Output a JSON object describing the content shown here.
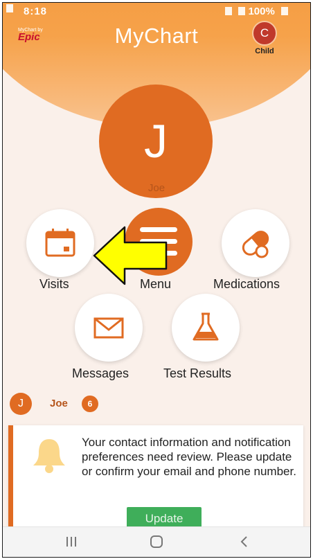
{
  "status": {
    "time": "8:18",
    "battery": "100%"
  },
  "header": {
    "brand_small": "MyChart by",
    "brand": "Epic",
    "title": "MyChart"
  },
  "proxy": {
    "initial": "C",
    "label": "Child"
  },
  "profile": {
    "initial": "J",
    "name": "Joe"
  },
  "tiles": {
    "visits": "Visits",
    "menu": "Menu",
    "medications": "Medications",
    "messages": "Messages",
    "test_results": "Test Results"
  },
  "person": {
    "initial": "J",
    "name": "Joe",
    "badge": "6"
  },
  "notice": {
    "text": "Your contact information and notification preferences need review. Please update or confirm your email and phone number.",
    "button": "Update"
  },
  "colors": {
    "accent": "#e06b22",
    "highlight_arrow": "#ffff00",
    "update": "#3fae5a"
  },
  "icons": {
    "visits": "calendar-icon",
    "menu": "hamburger-menu-icon",
    "medications": "pills-icon",
    "messages": "envelope-icon",
    "test_results": "flask-icon",
    "notice": "bell-icon"
  }
}
